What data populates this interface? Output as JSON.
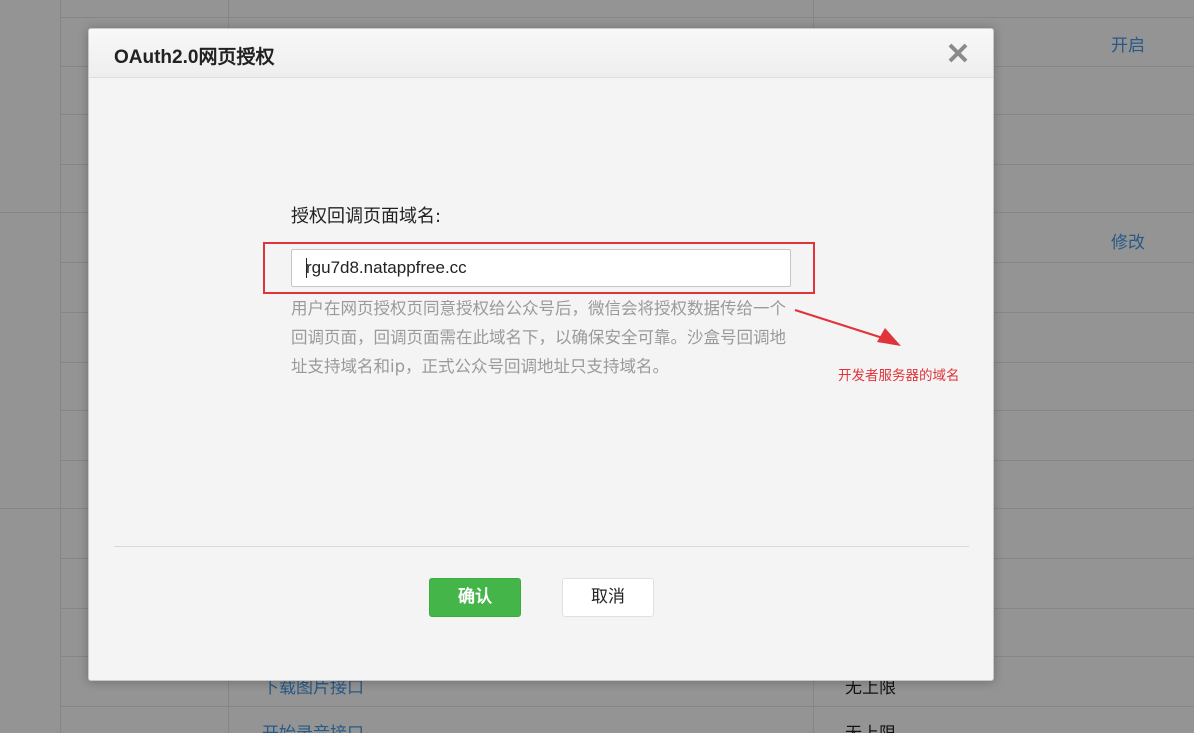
{
  "background": {
    "links": {
      "enable": "开启",
      "modify": "修改",
      "download_image": "下载图片接口",
      "start_recording": "开始录音接口"
    },
    "values": {
      "unlimited_1": "无上限",
      "unlimited_2": "无上限"
    }
  },
  "dialog": {
    "title": "OAuth2.0网页授权",
    "close_icon": "close-icon",
    "field_label": "授权回调页面域名:",
    "domain_input": {
      "value": "rgu7d8.natappfree.cc",
      "placeholder": ""
    },
    "tips": "用户在网页授权页同意授权给公众号后，微信会将授权数据传给一个回调页面，回调页面需在此域名下，以确保安全可靠。沙盒号回调地址支持域名和ip，正式公众号回调地址只支持域名。",
    "annotation": "开发者服务器的域名",
    "confirm_label": "确认",
    "cancel_label": "取消"
  },
  "colors": {
    "overlay": "rgba(0,0,0,0.42)",
    "primary_button": "#44b549",
    "annotation_red": "#e0343a",
    "link_blue": "#459ae9"
  }
}
